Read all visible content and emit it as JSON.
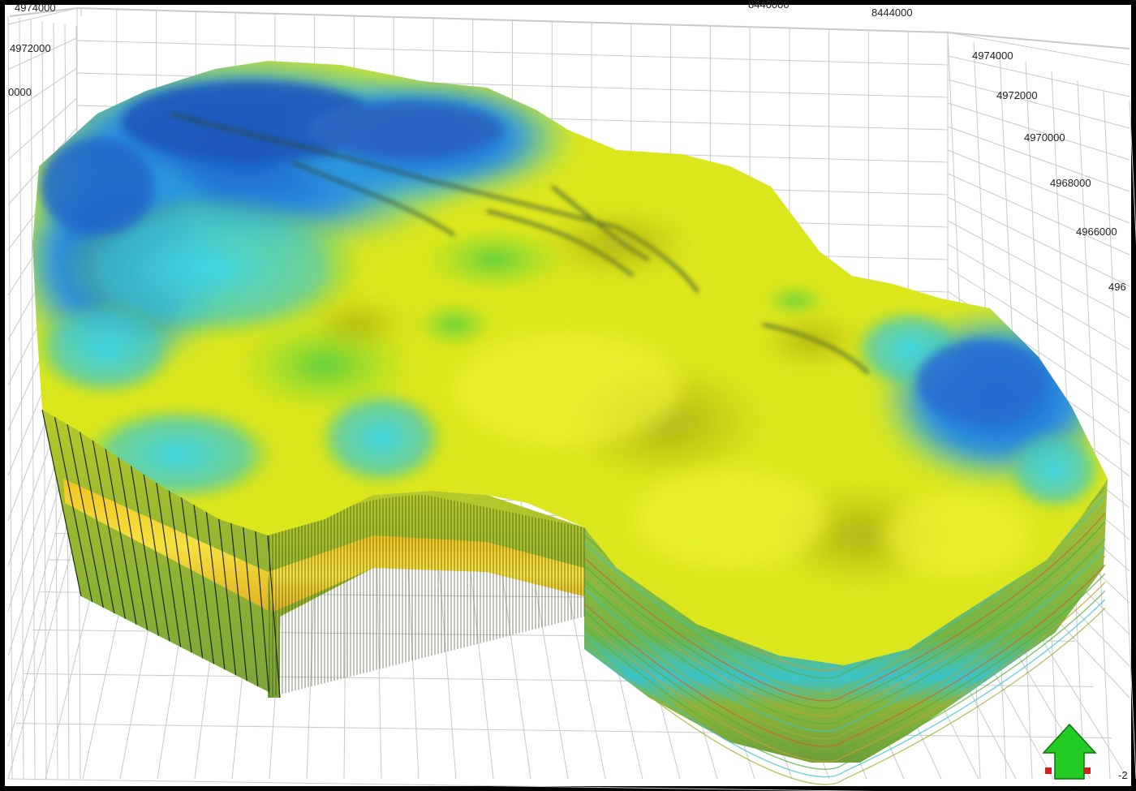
{
  "viewer": {
    "axis_labels": {
      "left": [
        "4974000",
        "4972000",
        "0000"
      ],
      "top": [
        "8440000",
        "8444000"
      ],
      "right": [
        "4974000",
        "4972000",
        "4970000",
        "4968000",
        "4966000",
        "496"
      ],
      "bottom_right": "-2"
    },
    "orientation_control": {
      "icon": "north-arrow-icon",
      "color": "#22cc22"
    },
    "colors": {
      "frame": "#000000",
      "background": "#ffffff",
      "grid": "#c9c9c9",
      "surface_yellow": "#dde81a",
      "surface_blue": "#1f6fcf",
      "surface_cyan": "#3ad4e0",
      "surface_green": "#6fcf3a"
    }
  }
}
